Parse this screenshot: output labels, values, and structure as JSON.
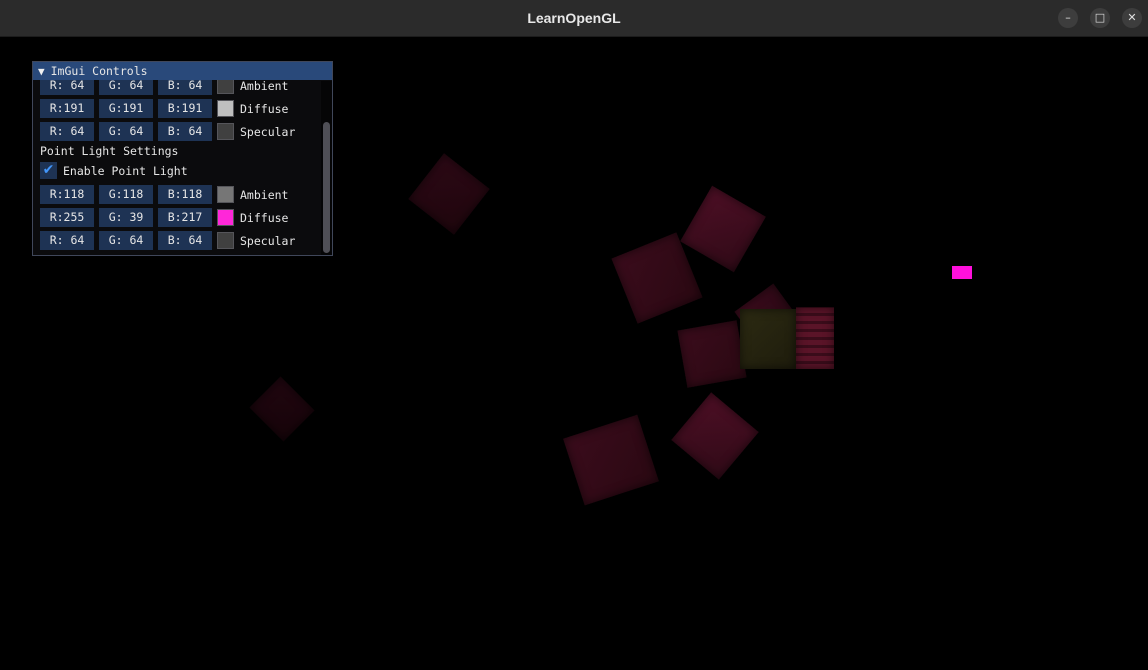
{
  "window": {
    "title": "LearnOpenGL",
    "controls": {
      "minimize_icon": "minimize-icon",
      "maximize_icon": "maximize-icon",
      "close_icon": "close-icon",
      "minimize_glyph": "–",
      "maximize_glyph": "□",
      "close_glyph": "✕"
    }
  },
  "imgui": {
    "header": {
      "arrow": "▼",
      "title": "ImGui Controls"
    },
    "dir_light_rows": [
      {
        "r": "R: 64",
        "g": "G: 64",
        "b": "B: 64",
        "label": "Ambient",
        "swatch": "#404040"
      },
      {
        "r": "R:191",
        "g": "G:191",
        "b": "B:191",
        "label": "Diffuse",
        "swatch": "#bfbfbf"
      },
      {
        "r": "R: 64",
        "g": "G: 64",
        "b": "B: 64",
        "label": "Specular",
        "swatch": "#404040"
      }
    ],
    "point_light": {
      "section_title": "Point Light Settings",
      "enable_label": "Enable Point Light",
      "enabled": true,
      "check_glyph": "✔",
      "rows": [
        {
          "r": "R:118",
          "g": "G:118",
          "b": "B:118",
          "label": "Ambient",
          "swatch": "#767676"
        },
        {
          "r": "R:255",
          "g": "G: 39",
          "b": "B:217",
          "label": "Diffuse",
          "swatch": "#ff27d9"
        },
        {
          "r": "R: 64",
          "g": "G: 64",
          "b": "B: 64",
          "label": "Specular",
          "swatch": "#404040"
        }
      ]
    }
  },
  "colors": {
    "header": "#29497a",
    "frame": "#1e3354",
    "check": "#4296fa",
    "light_cube": "#ff10dc"
  }
}
